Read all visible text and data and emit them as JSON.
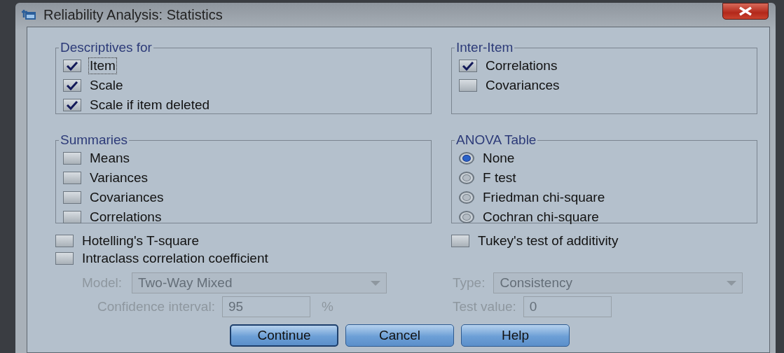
{
  "window": {
    "title": "Reliability Analysis: Statistics"
  },
  "descriptives": {
    "title": "Descriptives for",
    "items": [
      {
        "label": "Item",
        "checked": true,
        "focused": true
      },
      {
        "label": "Scale",
        "checked": true,
        "focused": false
      },
      {
        "label": "Scale if item deleted",
        "checked": true,
        "focused": false
      }
    ]
  },
  "inter_item": {
    "title": "Inter-Item",
    "items": [
      {
        "label": "Correlations",
        "checked": true,
        "focused": false
      },
      {
        "label": "Covariances",
        "checked": false,
        "focused": false
      }
    ]
  },
  "summaries": {
    "title": "Summaries",
    "items": [
      {
        "label": "Means",
        "checked": false,
        "focused": false
      },
      {
        "label": "Variances",
        "checked": false,
        "focused": false
      },
      {
        "label": "Covariances",
        "checked": false,
        "focused": false
      },
      {
        "label": "Correlations",
        "checked": false,
        "focused": false
      }
    ]
  },
  "anova": {
    "title": "ANOVA Table",
    "options": [
      {
        "label": "None",
        "selected": true
      },
      {
        "label": "F test",
        "selected": false
      },
      {
        "label": "Friedman chi-square",
        "selected": false
      },
      {
        "label": "Cochran chi-square",
        "selected": false
      }
    ]
  },
  "hotelling": {
    "label": "Hotelling's T-square",
    "checked": false,
    "focused": false
  },
  "tukey": {
    "label": "Tukey's test of additivity",
    "checked": false,
    "focused": false
  },
  "intraclass": {
    "label": "Intraclass correlation coefficient",
    "checked": false,
    "focused": false
  },
  "icc": {
    "disabled": true,
    "model": {
      "label": "Model:",
      "value": "Two-Way Mixed"
    },
    "type": {
      "label": "Type:",
      "value": "Consistency"
    },
    "confidence": {
      "label": "Confidence interval:",
      "value": "95",
      "unit": "%"
    },
    "test_value": {
      "label": "Test value:",
      "value": "0"
    }
  },
  "buttons": [
    {
      "label": "Continue",
      "default": true
    },
    {
      "label": "Cancel",
      "default": false
    },
    {
      "label": "Help",
      "default": false
    }
  ]
}
